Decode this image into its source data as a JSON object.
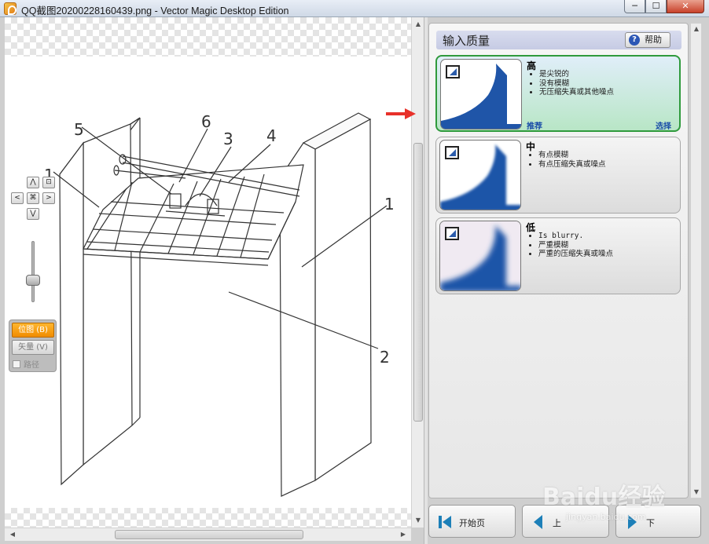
{
  "window": {
    "title": "QQ截图20200228160439.png - Vector Magic Desktop Edition",
    "minimize": "─",
    "maximize": "☐",
    "close": "✕"
  },
  "drawing_labels": [
    "1",
    "5",
    "6",
    "3",
    "4",
    "1",
    "2"
  ],
  "nav": {
    "up": "⋀",
    "down": "⋁",
    "left": "<",
    "right": ">",
    "fit": "⌘",
    "full": "⊡"
  },
  "mode": {
    "bitmap": "位图 (B)",
    "vector": "矢量 (V)",
    "paths": "路径"
  },
  "panel": {
    "title": "输入质量",
    "help": "帮助",
    "help_icon": "?"
  },
  "cards": {
    "high": {
      "title": "高",
      "bullets": [
        "是尖锐的",
        "没有模糊",
        "无压缩失真或其他噪点"
      ],
      "recommend": "推荐",
      "select": "选择"
    },
    "medium": {
      "title": "中",
      "bullets": [
        "有点模糊",
        "有点压缩失真或噪点"
      ]
    },
    "low": {
      "title": "低",
      "bullets": [
        "Is blurry.",
        "严重模糊",
        "严重的压缩失真或噪点"
      ]
    }
  },
  "bottom": {
    "start": "开始页",
    "back": "上",
    "next": "下"
  },
  "watermark": {
    "text": "Baidu经验",
    "url": "jingyan.baidu.com"
  },
  "colors": {
    "accent_orange": "#f08c00",
    "selected_green": "#2f9a3c",
    "thumb_blue": "#1f55a8",
    "arrow_red": "#e8312a"
  }
}
